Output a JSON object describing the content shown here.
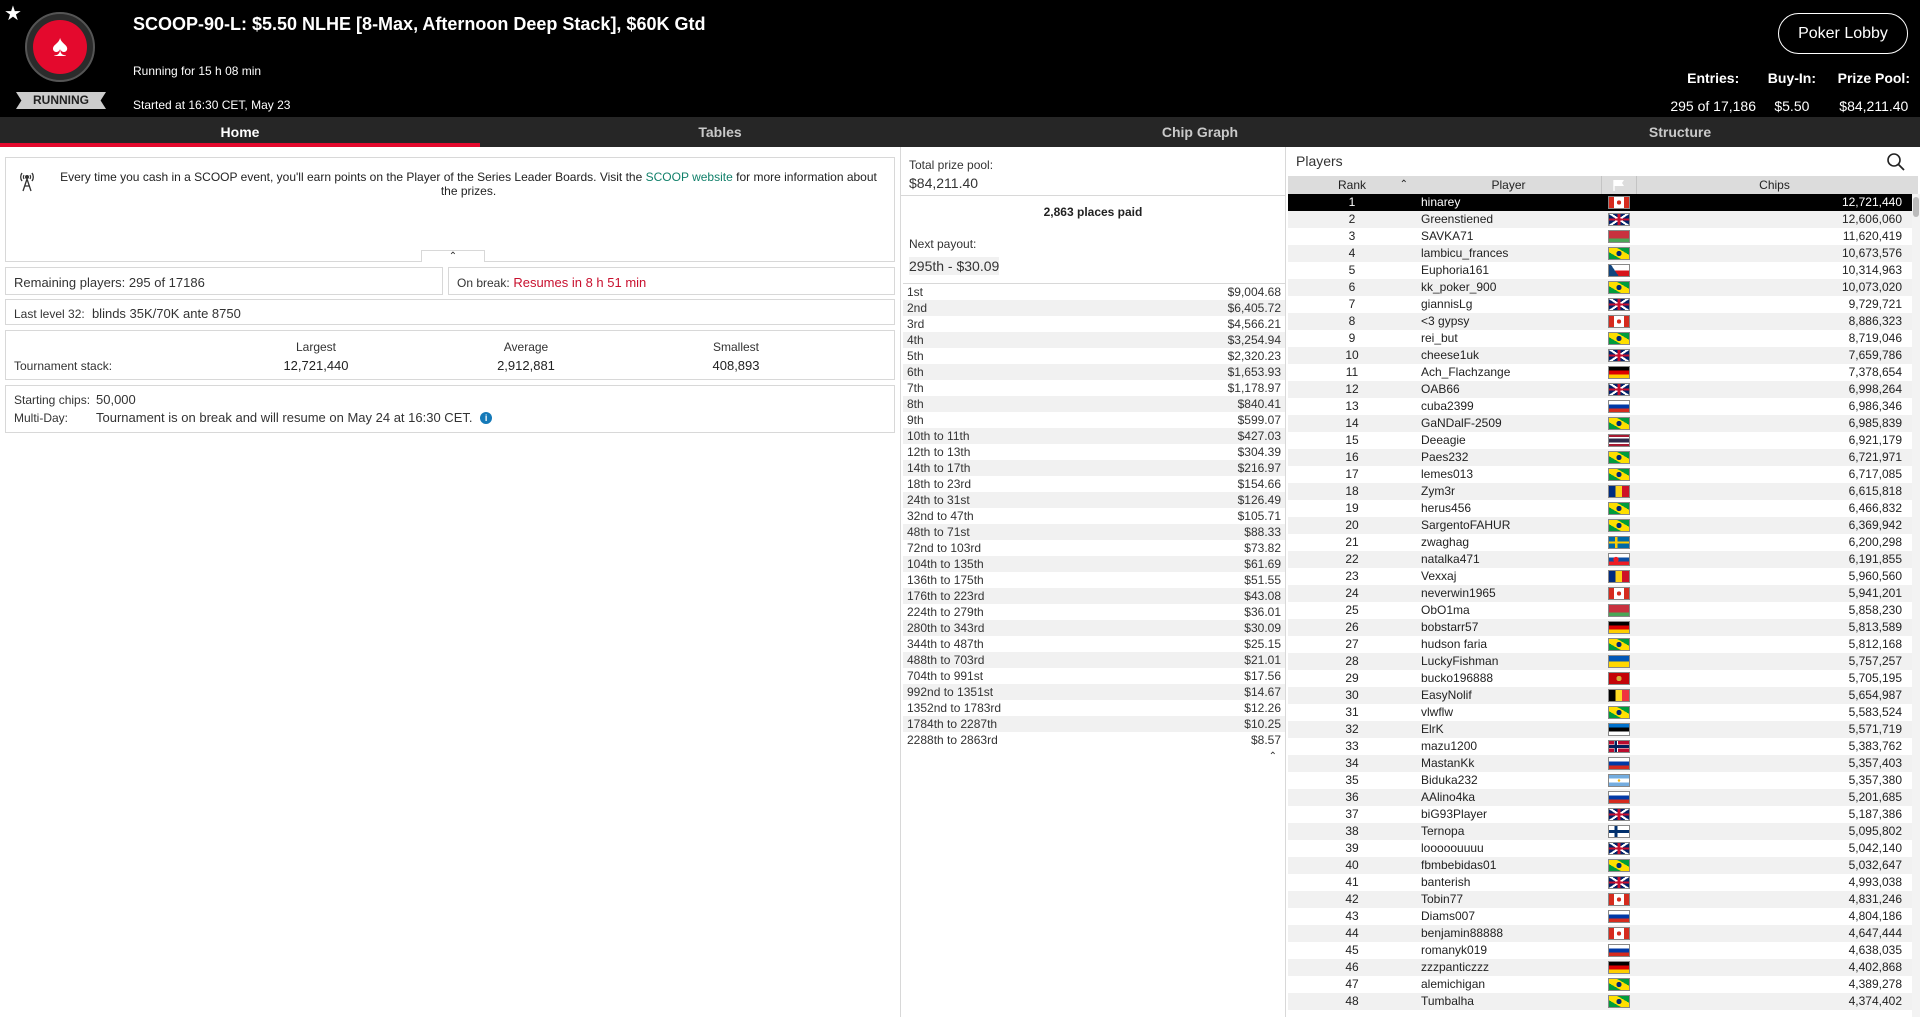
{
  "header": {
    "title": "SCOOP-90-L: $5.50 NLHE [8-Max, Afternoon Deep Stack], $60K Gtd",
    "running_for": "Running for 15 h 08 min",
    "started_at": "Started at 16:30 CET, May 23",
    "status": "RUNNING",
    "lobby_button": "Poker Lobby",
    "entries_label": "Entries:",
    "entries_value": "295 of 17,186",
    "buyin_label": "Buy-In:",
    "buyin_value": "$5.50",
    "prize_label": "Prize Pool:",
    "prize_value": "$84,211.40",
    "star_icon": "star-icon",
    "logo_icon": "pokerstars-spade-logo"
  },
  "tabs": [
    "Home",
    "Tables",
    "Chip Graph",
    "Structure"
  ],
  "info": {
    "text_before": "Every time you cash in a SCOOP event, you'll earn points on the Player of the Series Leader Boards. Visit the ",
    "link": "SCOOP website",
    "text_after": " for more information about the prizes."
  },
  "remaining": {
    "label": "Remaining players:",
    "value": "295 of 17186"
  },
  "on_break": {
    "label": "On break:",
    "value": "Resumes in 8 h 51 min"
  },
  "last_level": {
    "label": "Last level 32:",
    "value": "blinds 35K/70K ante 8750"
  },
  "stack": {
    "label": "Tournament stack:",
    "largest_label": "Largest",
    "largest": "12,721,440",
    "average_label": "Average",
    "average": "2,912,881",
    "smallest_label": "Smallest",
    "smallest": "408,893"
  },
  "chips": {
    "starting_label": "Starting chips:",
    "starting_value": "50,000",
    "multiday_label": "Multi-Day:",
    "multiday_value": "Tournament is on break and will resume on May 24 at 16:30 CET."
  },
  "prize": {
    "pool_label": "Total prize pool:",
    "pool_value": "$84,211.40",
    "places_paid": "2,863 places paid",
    "next_label": "Next payout:",
    "next_value": "295th - $30.09",
    "payouts": [
      [
        "1st",
        "$9,004.68"
      ],
      [
        "2nd",
        "$6,405.72"
      ],
      [
        "3rd",
        "$4,566.21"
      ],
      [
        "4th",
        "$3,254.94"
      ],
      [
        "5th",
        "$2,320.23"
      ],
      [
        "6th",
        "$1,653.93"
      ],
      [
        "7th",
        "$1,178.97"
      ],
      [
        "8th",
        "$840.41"
      ],
      [
        "9th",
        "$599.07"
      ],
      [
        "10th to 11th",
        "$427.03"
      ],
      [
        "12th to 13th",
        "$304.39"
      ],
      [
        "14th to 17th",
        "$216.97"
      ],
      [
        "18th to 23rd",
        "$154.66"
      ],
      [
        "24th to 31st",
        "$126.49"
      ],
      [
        "32nd to 47th",
        "$105.71"
      ],
      [
        "48th to 71st",
        "$88.33"
      ],
      [
        "72nd to 103rd",
        "$73.82"
      ],
      [
        "104th to 135th",
        "$61.69"
      ],
      [
        "136th to 175th",
        "$51.55"
      ],
      [
        "176th to 223rd",
        "$43.08"
      ],
      [
        "224th to 279th",
        "$36.01"
      ],
      [
        "280th to 343rd",
        "$30.09"
      ],
      [
        "344th to 487th",
        "$25.15"
      ],
      [
        "488th to 703rd",
        "$21.01"
      ],
      [
        "704th to 991st",
        "$17.56"
      ],
      [
        "992nd to 1351st",
        "$14.67"
      ],
      [
        "1352nd to 1783rd",
        "$12.26"
      ],
      [
        "1784th to 2287th",
        "$10.25"
      ],
      [
        "2288th to 2863rd",
        "$8.57"
      ]
    ]
  },
  "players": {
    "title": "Players",
    "col_rank": "Rank",
    "col_player": "Player",
    "col_chips": "Chips",
    "rows": [
      [
        "1",
        "hinarey",
        "canada",
        "12,721,440"
      ],
      [
        "2",
        "Greenstiened",
        "uk",
        "12,606,060"
      ],
      [
        "3",
        "SAVKA71",
        "belarus",
        "11,620,419"
      ],
      [
        "4",
        "lambicu_frances",
        "brazil",
        "10,673,576"
      ],
      [
        "5",
        "Euphoria161",
        "czech",
        "10,314,963"
      ],
      [
        "6",
        "kk_poker_900",
        "brazil",
        "10,073,020"
      ],
      [
        "7",
        "giannisLg",
        "uk",
        "9,729,721"
      ],
      [
        "8",
        "<3 gypsy",
        "canada",
        "8,886,323"
      ],
      [
        "9",
        "rei_but",
        "brazil",
        "8,719,046"
      ],
      [
        "10",
        "cheese1uk",
        "uk",
        "7,659,786"
      ],
      [
        "11",
        "Ach_Flachzange",
        "germany",
        "7,378,654"
      ],
      [
        "12",
        "OAB66",
        "uk",
        "6,998,264"
      ],
      [
        "13",
        "cuba2399",
        "russia",
        "6,986,346"
      ],
      [
        "14",
        "GaNDalF-2509",
        "brazil",
        "6,985,839"
      ],
      [
        "15",
        "Deeagie",
        "thailand",
        "6,921,179"
      ],
      [
        "16",
        "Paes232",
        "brazil",
        "6,721,971"
      ],
      [
        "17",
        "lemes013",
        "brazil",
        "6,717,085"
      ],
      [
        "18",
        "Zym3r",
        "romania",
        "6,615,818"
      ],
      [
        "19",
        "herus456",
        "brazil",
        "6,466,832"
      ],
      [
        "20",
        "SargentoFAHUR",
        "brazil",
        "6,369,942"
      ],
      [
        "21",
        "zwaghag",
        "sweden",
        "6,200,298"
      ],
      [
        "22",
        "natalka471",
        "slovakia",
        "6,191,855"
      ],
      [
        "23",
        "Vexxaj",
        "romania",
        "5,960,560"
      ],
      [
        "24",
        "neverwin1965",
        "canada",
        "5,941,201"
      ],
      [
        "25",
        "ObO1ma",
        "belarus",
        "5,858,230"
      ],
      [
        "26",
        "bobstarr57",
        "germany",
        "5,813,589"
      ],
      [
        "27",
        "hudson faria",
        "brazil",
        "5,812,168"
      ],
      [
        "28",
        "LuckyFishman",
        "ukraine",
        "5,757,257"
      ],
      [
        "29",
        "bucko196888",
        "montenegro",
        "5,705,195"
      ],
      [
        "30",
        "EasyNolif",
        "belgium",
        "5,654,987"
      ],
      [
        "31",
        "vlwflw",
        "brazil",
        "5,583,524"
      ],
      [
        "32",
        "ElrK",
        "estonia",
        "5,571,719"
      ],
      [
        "33",
        "mazu1200",
        "norway",
        "5,383,762"
      ],
      [
        "34",
        "MastanKk",
        "russia",
        "5,357,403"
      ],
      [
        "35",
        "Biduka232",
        "argentina",
        "5,357,380"
      ],
      [
        "36",
        "AAlino4ka",
        "russia",
        "5,201,685"
      ],
      [
        "37",
        "biG93Player",
        "uk",
        "5,187,386"
      ],
      [
        "38",
        "Ternopa",
        "finland",
        "5,095,802"
      ],
      [
        "39",
        "looooouuuu",
        "uk",
        "5,042,140"
      ],
      [
        "40",
        "fbmbebidas01",
        "brazil",
        "5,032,647"
      ],
      [
        "41",
        "banterish",
        "uk",
        "4,993,038"
      ],
      [
        "42",
        "Tobin77",
        "canada",
        "4,831,246"
      ],
      [
        "43",
        "Diams007",
        "russia",
        "4,804,186"
      ],
      [
        "44",
        "benjamin88888",
        "canada",
        "4,647,444"
      ],
      [
        "45",
        "romanyk019",
        "russia",
        "4,638,035"
      ],
      [
        "46",
        "zzzpanticzzz",
        "germany",
        "4,402,868"
      ],
      [
        "47",
        "alemichigan",
        "brazil",
        "4,389,278"
      ],
      [
        "48",
        "Tumbalha",
        "brazil",
        "4,374,402"
      ]
    ]
  },
  "colors": {
    "accent_red": "#e4092d",
    "link_green": "#11806a",
    "break_red": "#c8102e"
  }
}
